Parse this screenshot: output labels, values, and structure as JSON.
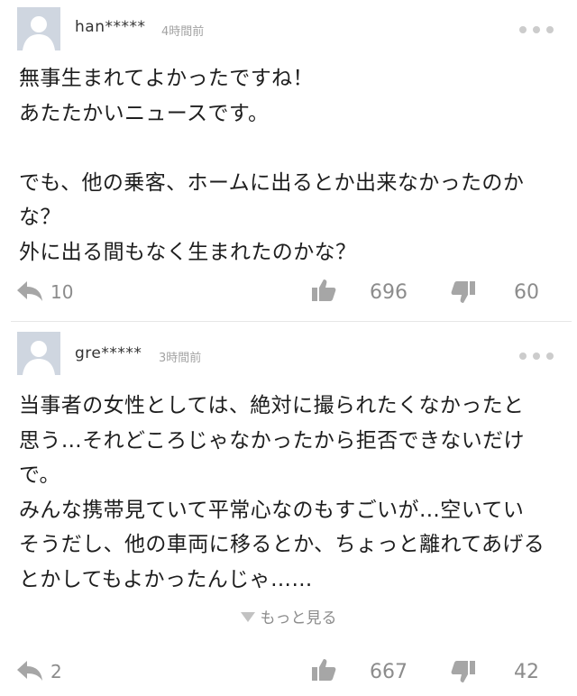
{
  "comments": [
    {
      "username": "han*****",
      "time": "4時間前",
      "body": "無事生まれてよかったですね！\nあたたかいニュースです。\n\nでも、他の乗客、ホームに出るとか出来なかったのか\nな？\n外に出る間もなく生まれたのかな？",
      "replies": "10",
      "likes": "696",
      "dislikes": "60"
    },
    {
      "username": "gre*****",
      "time": "3時間前",
      "body": "当事者の女性としては、絶対に撮られたくなかったと\n思う…それどころじゃなかったから拒否できないだけ\nで。\nみんな携帯見ていて平常心なのもすごいが…空いてい\nそうだし、他の車両に移るとか、ちょっと離れてあげる\nとかしてもよかったんじゃ……",
      "show_more": "もっと見る",
      "replies": "2",
      "likes": "667",
      "dislikes": "42"
    }
  ],
  "colors": {
    "icon": "#a6a6a6",
    "count_text": "#8c8c8c",
    "avatar_bg": "#cfd6e0"
  },
  "icons": [
    "avatar-default-icon",
    "more-options-icon",
    "reply-arrow-icon",
    "thumbs-up-icon",
    "thumbs-down-icon",
    "triangle-down-icon"
  ]
}
